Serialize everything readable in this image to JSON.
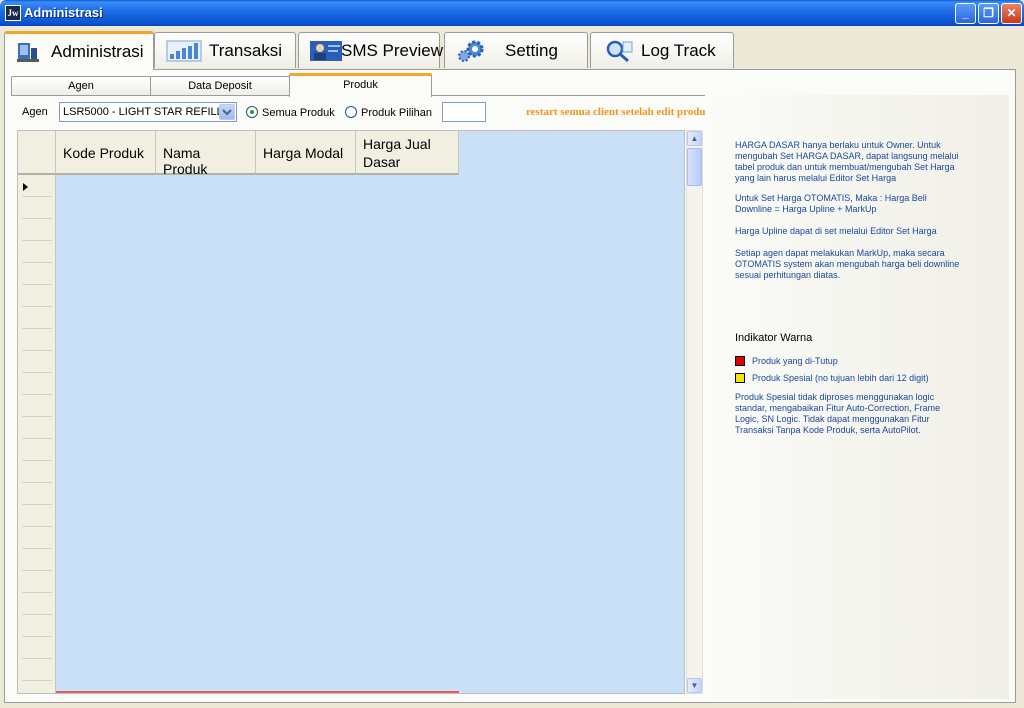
{
  "window": {
    "title": "Administrasi",
    "app_icon_text": "Jw"
  },
  "main_tabs": [
    {
      "label": "Administrasi",
      "active": true
    },
    {
      "label": "Transaksi",
      "active": false
    },
    {
      "label": "SMS Preview",
      "active": false
    },
    {
      "label": "Setting",
      "active": false
    },
    {
      "label": "Log Track",
      "active": false
    }
  ],
  "sub_tabs": [
    {
      "label": "Agen",
      "active": false
    },
    {
      "label": "Data Deposit",
      "active": false
    },
    {
      "label": "Produk",
      "active": true
    }
  ],
  "filter": {
    "agen_label": "Agen",
    "agen_value": "LSR5000 - LIGHT STAR REFILL",
    "radio_all": "Semua Produk",
    "radio_selected": "Produk Pilihan",
    "selected_mode": "Semua Produk",
    "warning": "restart semua client setelah edit produk"
  },
  "grid": {
    "columns": [
      "Kode Produk",
      "Nama Produk",
      "Harga Modal",
      "Harga Jual Dasar"
    ],
    "rows": []
  },
  "info": {
    "para1": "HARGA DASAR hanya berlaku untuk Owner. Untuk mengubah Set HARGA DASAR, dapat langsung melalui tabel produk dan untuk membuat/mengubah Set Harga yang lain harus melalui Editor Set Harga",
    "para2": "Untuk Set Harga OTOMATIS, Maka : Harga Beli Downline = Harga Upline + MarkUp",
    "para3": "Harga Upline dapat di set melalui Editor Set Harga",
    "para4": "Setiap agen dapat melakukan MarkUp, maka secara OTOMATIS system akan mengubah harga beli downline sesuai perhitungan diatas.",
    "indikator_title": "Indikator Warna",
    "legend": [
      {
        "label": "Produk yang di-Tutup",
        "color": "#e00000"
      },
      {
        "label": "Produk Spesial (no tujuan lebih dari 12 digit)",
        "color": "#f4e600"
      }
    ],
    "para5": "Produk Spesial tidak diproses menggunakan logic standar, mengabaikan Fitur Auto-Correction, Frame Logic, SN Logic. Tidak dapat menggunakan Fitur Transaksi Tanpa Kode Produk, serta AutoPilot."
  }
}
